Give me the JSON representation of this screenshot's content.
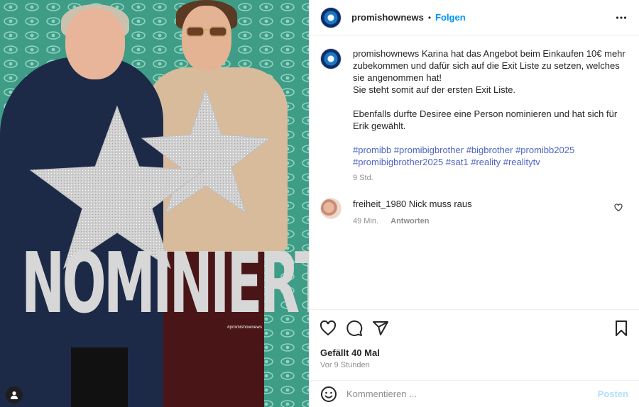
{
  "media": {
    "overlay_text": "NOMINIERT",
    "watermark": "#promishownews",
    "colors": {
      "background": "#3f9c86",
      "eye_pattern": "#8fd4c1"
    },
    "icons": {
      "tag_users": "person-icon"
    }
  },
  "header": {
    "username": "promishownews",
    "separator": "•",
    "follow_label": "Folgen",
    "more_icon": "more-horizontal-icon"
  },
  "caption": {
    "username": "promishownews",
    "lines": [
      "Karina hat das Angebot beim Einkaufen 10€ mehr zubekommen und dafür sich auf die Exit Liste zu setzen, welches sie angenommen hat!",
      "Sie steht somit auf der ersten Exit Liste.",
      "Ebenfalls durfte Desiree eine Person nominieren und hat sich für Erik gewählt."
    ],
    "hashtags": "#promibb #promibigbrother #bigbrother #promibb2025 #promibigbrother2025 #sat1 #reality #realitytv",
    "time": "9 Std."
  },
  "comment": {
    "username": "freiheit_1980",
    "text": "Nick muss raus",
    "time": "49 Min.",
    "reply_label": "Antworten"
  },
  "actions": {
    "likes": "Gefällt 40 Mal",
    "posted_ago": "Vor 9 Stunden",
    "icons": [
      "heart-icon",
      "comment-icon",
      "share-icon",
      "bookmark-icon"
    ]
  },
  "add_comment": {
    "placeholder": "Kommentieren ...",
    "post_label": "Posten",
    "colors": {
      "post_disabled": "#b2dffc",
      "follow": "#0095f6"
    }
  }
}
